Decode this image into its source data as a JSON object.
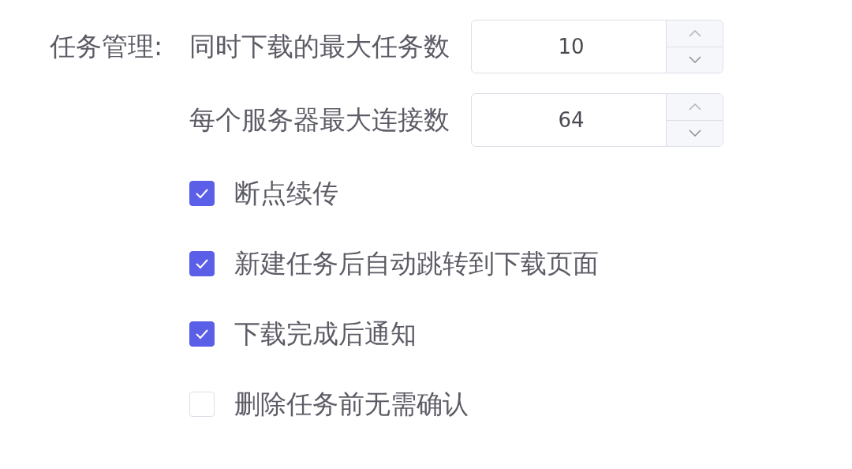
{
  "section": {
    "label": "任务管理:"
  },
  "fields": [
    {
      "label": "同时下载的最大任务数",
      "value": "10"
    },
    {
      "label": "每个服务器最大连接数",
      "value": "64"
    }
  ],
  "options": [
    {
      "label": "断点续传",
      "checked": true
    },
    {
      "label": "新建任务后自动跳转到下载页面",
      "checked": true
    },
    {
      "label": "下载完成后通知",
      "checked": true
    },
    {
      "label": "删除任务前无需确认",
      "checked": false
    }
  ]
}
